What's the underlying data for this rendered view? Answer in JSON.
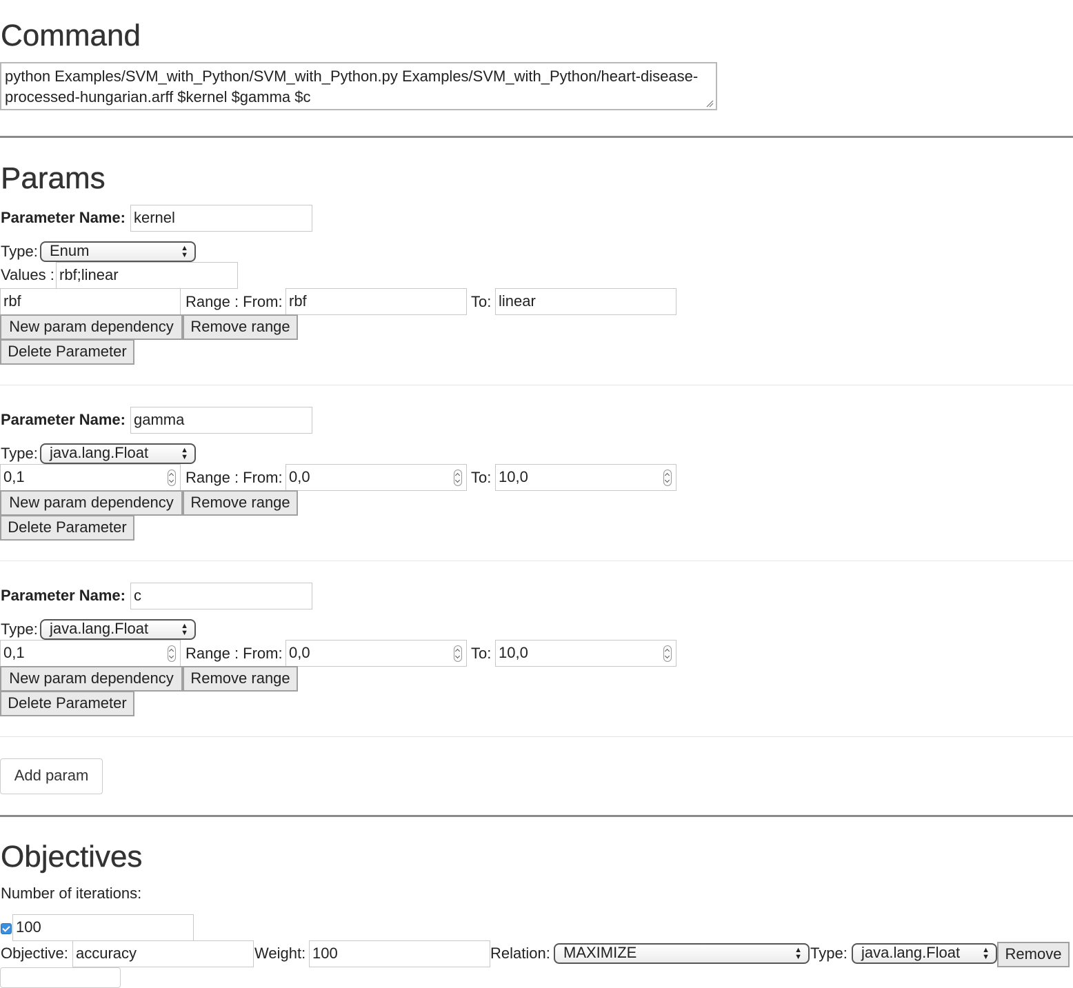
{
  "command": {
    "heading": "Command",
    "text": "python Examples/SVM_with_Python/SVM_with_Python.py Examples/SVM_with_Python/heart-disease-processed-hungarian.arff $kernel $gamma $c"
  },
  "params": {
    "heading": "Params",
    "labels": {
      "name": "Parameter Name:",
      "type": "Type:",
      "values": "Values :",
      "range_from": "Range : From:",
      "to": "To:"
    },
    "buttons": {
      "new_dependency": "New param dependency",
      "remove_range": "Remove range",
      "delete": "Delete Parameter"
    },
    "items": [
      {
        "name": "kernel",
        "type": "Enum",
        "values": "rbf;linear",
        "value": "rbf",
        "from": "rbf",
        "to": "linear"
      },
      {
        "name": "gamma",
        "type": "java.lang.Float",
        "value": "0,1",
        "from": "0,0",
        "to": "10,0"
      },
      {
        "name": "c",
        "type": "java.lang.Float",
        "value": "0,1",
        "from": "0,0",
        "to": "10,0"
      }
    ],
    "add_button": "Add param"
  },
  "objectives": {
    "heading": "Objectives",
    "iterations_label": "Number of iterations:",
    "iterations_checked": true,
    "iterations_value": "100",
    "objective_label": "Objective:",
    "objective_value": "accuracy",
    "weight_label": "Weight:",
    "weight_value": "100",
    "relation_label": "Relation:",
    "relation_value": "MAXIMIZE",
    "type_label": "Type:",
    "type_value": "java.lang.Float",
    "remove_label": "Remove"
  },
  "colors": {
    "text": "#333333",
    "divider": "#8a8a8a",
    "button_bg": "#e9e9e9",
    "checkbox": "#3b8fe0"
  },
  "icons": [
    "resize-grip-icon",
    "select-arrows-icon",
    "spinner-icon",
    "checkmark-icon"
  ]
}
